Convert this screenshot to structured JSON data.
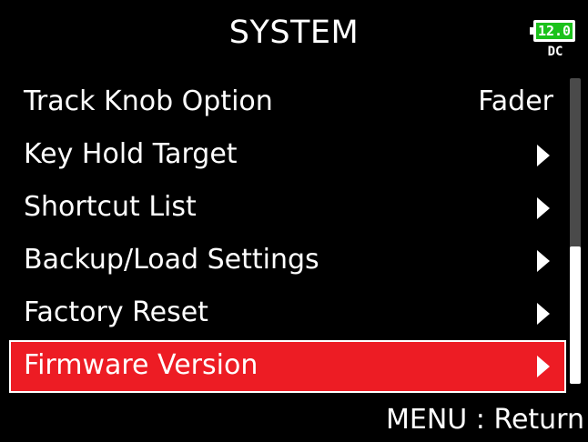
{
  "header": {
    "title": "SYSTEM"
  },
  "battery": {
    "voltage": "12.0",
    "source": "DC",
    "fill_color": "#1cc21c"
  },
  "menu": {
    "items": [
      {
        "label": "Track Knob Option",
        "value": "Fader",
        "has_arrow": false,
        "selected": false
      },
      {
        "label": "Key Hold Target",
        "value": "",
        "has_arrow": true,
        "selected": false
      },
      {
        "label": "Shortcut List",
        "value": "",
        "has_arrow": true,
        "selected": false
      },
      {
        "label": "Backup/Load Settings",
        "value": "",
        "has_arrow": true,
        "selected": false
      },
      {
        "label": "Factory Reset",
        "value": "",
        "has_arrow": true,
        "selected": false
      },
      {
        "label": "Firmware Version",
        "value": "",
        "has_arrow": true,
        "selected": true
      }
    ]
  },
  "scrollbar": {
    "thumb_start": 0.55,
    "thumb_end": 1.0
  },
  "footer": {
    "hint": "MENU : Return"
  },
  "colors": {
    "background": "#000000",
    "selection": "#ed1c24",
    "text": "#ffffff",
    "battery_green": "#1cc21c"
  }
}
